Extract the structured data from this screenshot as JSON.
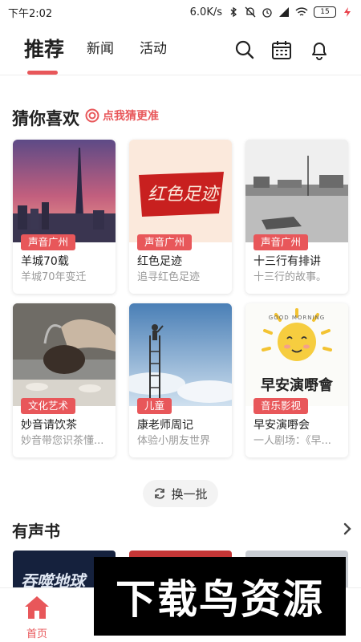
{
  "status_bar": {
    "time": "下午2:02",
    "speed": "6.0K/s",
    "battery": "15"
  },
  "header": {
    "tabs": [
      {
        "label": "推荐",
        "active": true
      },
      {
        "label": "新闻",
        "active": false
      },
      {
        "label": "活动",
        "active": false
      }
    ],
    "icons": [
      "search-icon",
      "calendar-icon",
      "bell-icon"
    ]
  },
  "guess": {
    "title": "猜你喜欢",
    "link": "点我猜更准",
    "cards": [
      {
        "tag": "声音广州",
        "title": "羊城70载",
        "subtitle": "羊城70年变迁"
      },
      {
        "tag": "声音广州",
        "title": "红色足迹",
        "subtitle": "追寻红色足迹",
        "art_text": "红色足迹"
      },
      {
        "tag": "声音广州",
        "title": "十三行有排讲",
        "subtitle": "十三行的故事。"
      },
      {
        "tag": "文化艺术",
        "title": "妙音请饮茶",
        "subtitle": "妙音带您识茶懂..."
      },
      {
        "tag": "儿童",
        "title": "康老师周记",
        "subtitle": "体验小朋友世界"
      },
      {
        "tag": "音乐影视",
        "title": "早安演嘢会",
        "subtitle": "一人剧场：《早...",
        "art_top": "GOOD MORNING",
        "art_text": "早安演嘢會"
      }
    ],
    "refresh_label": "换一批"
  },
  "audiobook": {
    "title": "有声书",
    "first_cover_text": "吞噬地球"
  },
  "bottom_nav": {
    "home_label": "首页"
  },
  "watermark": "下载鸟资源",
  "colors": {
    "accent": "#e8575a",
    "text": "#222222",
    "subtext": "#999999"
  }
}
